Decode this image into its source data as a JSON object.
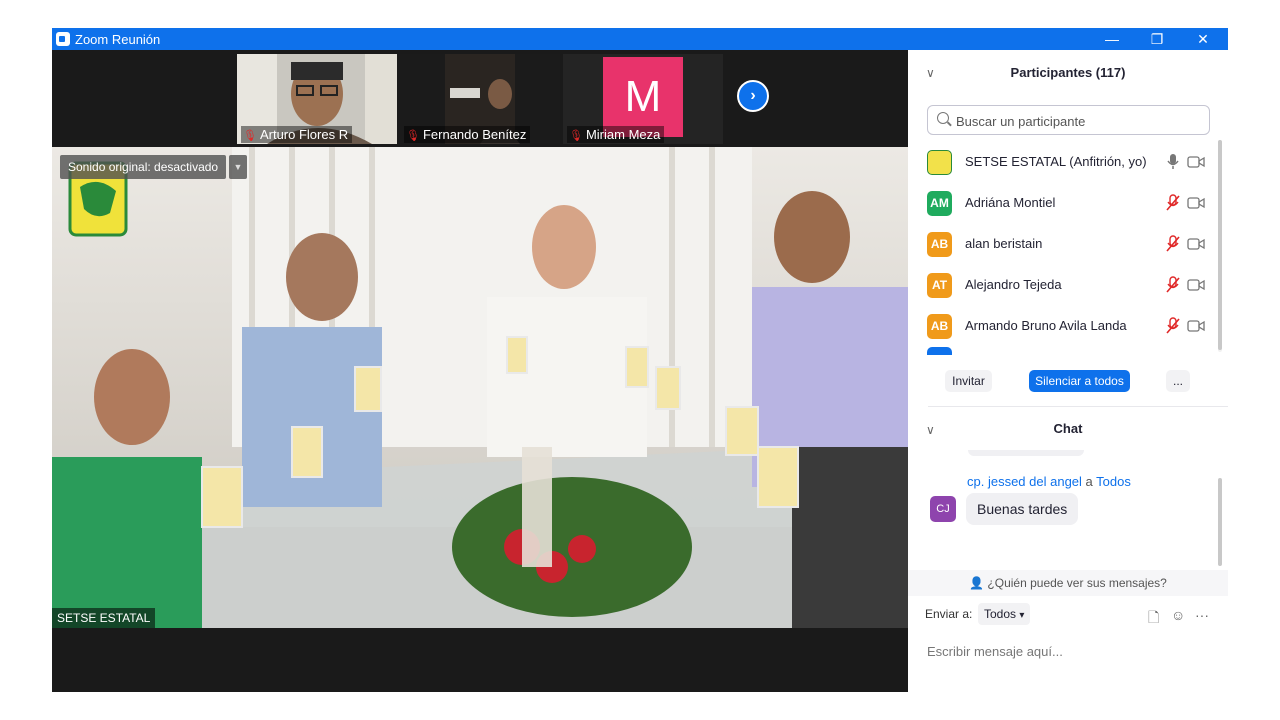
{
  "window": {
    "title": "Zoom Reunión"
  },
  "thumbnails": [
    {
      "name": "Arturo Flores R",
      "muted": true
    },
    {
      "name": "Fernando Benítez",
      "muted": true
    },
    {
      "name": "Miriam Meza",
      "muted": true,
      "initial": "M",
      "color": "#e8336b"
    }
  ],
  "main_video": {
    "sound_label": "Sonido original: desactivado",
    "name": "SETSE ESTATAL"
  },
  "participants": {
    "title": "Participantes (117)",
    "search_placeholder": "Buscar un participante",
    "list": [
      {
        "initials": "",
        "name": "SETSE ESTATAL (Anfitrión, yo)",
        "color": "#f2e14a",
        "muted": false
      },
      {
        "initials": "AM",
        "name": "Adriána Montiel",
        "color": "#1fab5e",
        "muted": true
      },
      {
        "initials": "AB",
        "name": "alan beristain",
        "color": "#f09a1a",
        "muted": true
      },
      {
        "initials": "AT",
        "name": "Alejandro Tejeda",
        "color": "#f09a1a",
        "muted": true
      },
      {
        "initials": "AB",
        "name": "Armando Bruno Avila Landa",
        "color": "#f09a1a",
        "muted": true
      }
    ],
    "invite_label": "Invitar",
    "mute_all_label": "Silenciar a todos",
    "more_label": "..."
  },
  "chat": {
    "title": "Chat",
    "sender": "cp. jessed  del angel",
    "to_word": "a",
    "recipient": "Todos",
    "avatar_initials": "CJ",
    "message": "Buenas tardes",
    "who_can_see": "¿Quién puede ver sus mensajes?",
    "send_to_label": "Enviar a:",
    "send_to_value": "Todos",
    "compose_placeholder": "Escribir mensaje aquí..."
  },
  "colors": {
    "accent": "#0e71eb",
    "muted_mic": "#e02828"
  }
}
